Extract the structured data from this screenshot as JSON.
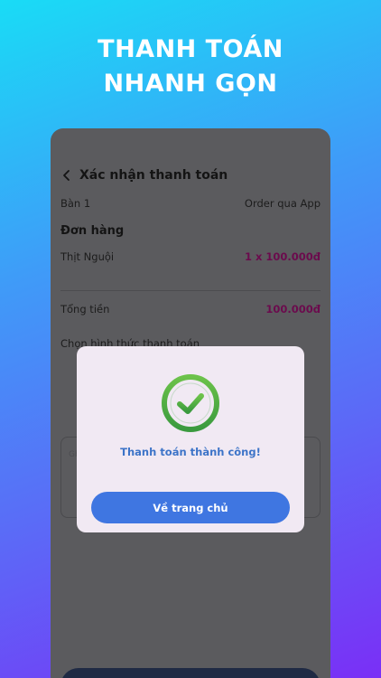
{
  "headline": {
    "line1": "THANH TOÁN",
    "line2": "NHANH GỌN"
  },
  "screen": {
    "title": "Xác nhận thanh toán",
    "table_label": "Bàn 1",
    "order_source": "Order qua App",
    "section_title": "Đơn hàng",
    "items": [
      {
        "name": "Thịt Nguội",
        "qty_price": "1 x 100.000đ"
      }
    ],
    "total_label": "Tổng tiền",
    "total_value": "100.000đ",
    "payment_method_label": "Chọn hình thức thanh toán",
    "note_placeholder": "Gh"
  },
  "modal": {
    "icon": "check-circle-icon",
    "message": "Thanh toán thành công!",
    "home_button_label": "Về trang chủ"
  },
  "colors": {
    "success_green": "#4caf50",
    "accent_blue": "#3f76e1",
    "price_color": "#6b0b4d"
  }
}
